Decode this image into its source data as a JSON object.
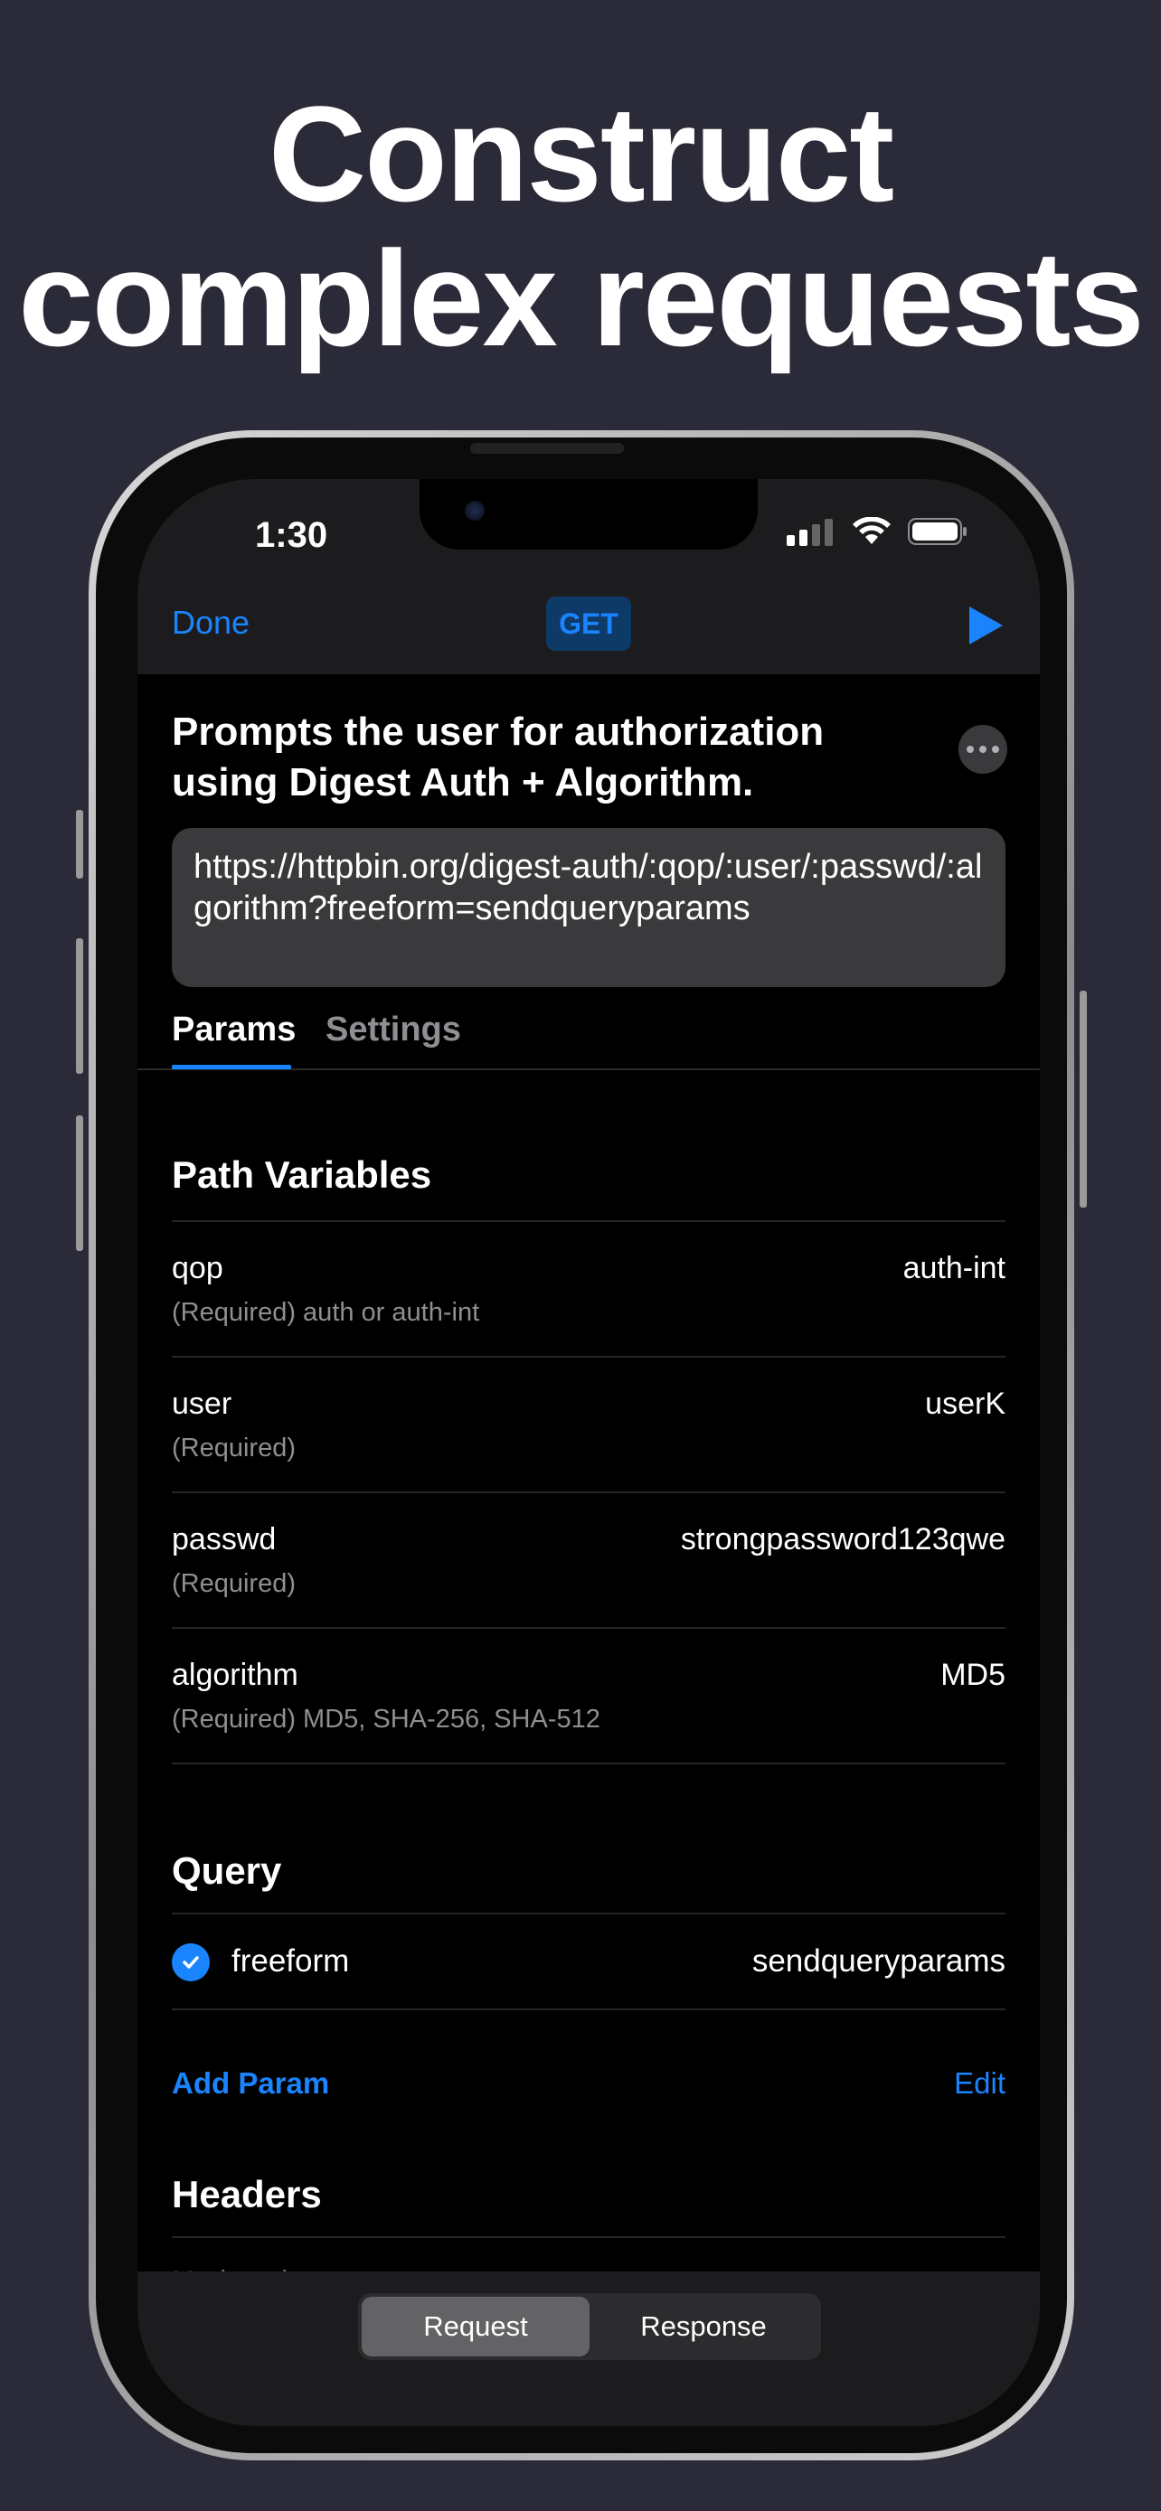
{
  "headline": {
    "line1": "Construct",
    "line2": "complex requests"
  },
  "status_bar": {
    "time": "1:30",
    "icons": [
      "cellular-signal-icon",
      "wifi-icon",
      "battery-icon"
    ]
  },
  "nav": {
    "done_label": "Done",
    "method": "GET",
    "run_icon": "play-icon"
  },
  "request": {
    "title": "Prompts the user for authorization using Digest Auth + Algorithm.",
    "url": "https://httpbin.org/digest-auth/:qop/:user/:passwd/:algorithm?freeform=sendqueryparams"
  },
  "tabs": [
    {
      "label": "Params",
      "active": true
    },
    {
      "label": "Settings",
      "active": false
    }
  ],
  "path_variables": {
    "title": "Path Variables",
    "rows": [
      {
        "name": "qop",
        "description": "(Required) auth or auth-int",
        "value": "auth-int"
      },
      {
        "name": "user",
        "description": "(Required)",
        "value": "userK"
      },
      {
        "name": "passwd",
        "description": "(Required)",
        "value": "strongpassword123qwe"
      },
      {
        "name": "algorithm",
        "description": "(Required) MD5, SHA-256, SHA-512",
        "value": "MD5"
      }
    ]
  },
  "query": {
    "title": "Query",
    "rows": [
      {
        "name": "freeform",
        "value": "sendqueryparams",
        "checked": true
      }
    ],
    "add_label": "Add Param",
    "edit_label": "Edit"
  },
  "headers": {
    "title": "Headers",
    "empty_text": "No headers yet"
  },
  "bottom_segment": {
    "options": [
      "Request",
      "Response"
    ],
    "selected": "Request"
  },
  "colors": {
    "accent": "#1a84ff",
    "background": "#2b2a38",
    "screen": "#000000"
  }
}
